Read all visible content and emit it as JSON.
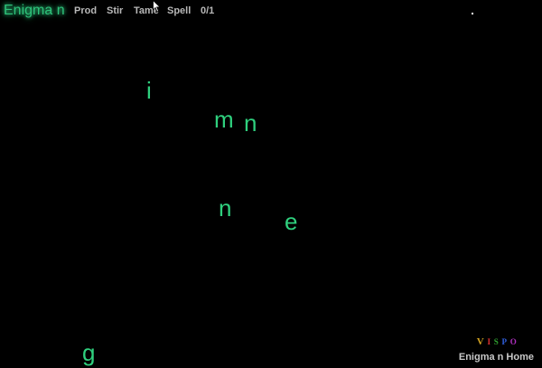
{
  "header": {
    "logo": "Enigma n",
    "menu": [
      "Prod",
      "Stir",
      "Tame",
      "Spell",
      "0/1"
    ]
  },
  "letters": [
    "i",
    "m",
    "n",
    "n",
    "e",
    "g"
  ],
  "footer": {
    "brand_letters": [
      "V",
      "I",
      "S",
      "P",
      "O"
    ],
    "brand_colors": [
      "#d0a020",
      "#e03030",
      "#30a030",
      "#3060e0",
      "#b030c0"
    ],
    "home_label": "Enigma n Home"
  },
  "colors": {
    "background": "#000000",
    "letter": "#2fd07e",
    "logo_glow": "#2ec27a",
    "menu_text": "#b8b8b8"
  }
}
